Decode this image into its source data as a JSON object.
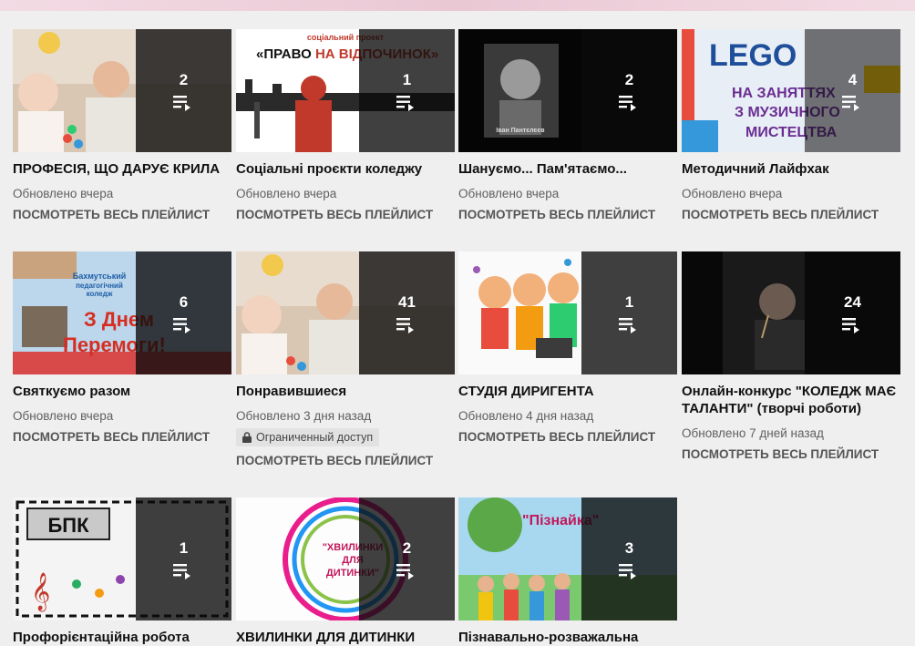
{
  "playlists": [
    {
      "title": "ПРОФЕСІЯ, ЩО ДАРУЄ КРИЛА",
      "count": "2",
      "updated": "Обновлено вчера",
      "link": "ПОСМОТРЕТЬ ВЕСЬ ПЛЕЙЛИСТ"
    },
    {
      "title": "Соціальні проєкти коледжу",
      "count": "1",
      "updated": "Обновлено вчера",
      "link": "ПОСМОТРЕТЬ ВЕСЬ ПЛЕЙЛИСТ",
      "art_small": "соціальний проект",
      "art_text1": "«ПРАВО ",
      "art_text2": "НА ВІДПОЧИНОК»"
    },
    {
      "title": "Шануємо... Пам'ятаємо...",
      "count": "2",
      "updated": "Обновлено вчера",
      "link": "ПОСМОТРЕТЬ ВЕСЬ ПЛЕЙЛИСТ",
      "art_caption": "Іван Пантєлєєв"
    },
    {
      "title": "Методичний Лайфхак",
      "count": "4",
      "updated": "Обновлено вчера",
      "link": "ПОСМОТРЕТЬ ВЕСЬ ПЛЕЙЛИСТ",
      "art_lego": "LEGO",
      "art_l1": "НА ЗАНЯТТЯХ",
      "art_l2": "З МУЗИЧНОГО",
      "art_l3": "МИСТЕЦТВА"
    },
    {
      "title": "Святкуємо разом",
      "count": "6",
      "updated": "Обновлено вчера",
      "link": "ПОСМОТРЕТЬ ВЕСЬ ПЛЕЙЛИСТ",
      "art_h1": "Бахмутський",
      "art_h2": "педагогічний",
      "art_h3": "коледж",
      "art_big1": "З Днем",
      "art_big2": "Перемоги!"
    },
    {
      "title": "Понравившиеся",
      "count": "41",
      "updated": "Обновлено 3 дня назад",
      "badge": "Ограниченный доступ",
      "link": "ПОСМОТРЕТЬ ВЕСЬ ПЛЕЙЛИСТ"
    },
    {
      "title": "СТУДІЯ ДИРИГЕНТА",
      "count": "1",
      "updated": "Обновлено 4 дня назад",
      "link": "ПОСМОТРЕТЬ ВЕСЬ ПЛЕЙЛИСТ"
    },
    {
      "title": "Онлайн-конкурс \"КОЛЕДЖ МАЄ ТАЛАНТИ\" (творчі роботи)",
      "count": "24",
      "updated": "Обновлено 7 дней назад",
      "link": "ПОСМОТРЕТЬ ВЕСЬ ПЛЕЙЛИСТ"
    },
    {
      "title": "Профорієнтаційна робота",
      "count": "1",
      "art_label": "БПК"
    },
    {
      "title": "ХВИЛИНКИ ДЛЯ ДИТИНКИ",
      "count": "2",
      "art_t1": "\"ХВИЛИНКИ",
      "art_t2": "ДЛЯ",
      "art_t3": "ДИТИНКИ\""
    },
    {
      "title": "Пізнавально-розважальна",
      "count": "3",
      "art_label": "\"Пізнайка\""
    }
  ],
  "colors": {
    "background": "#efefef",
    "overlay": "#0a0a0a",
    "title": "#111111",
    "meta": "#606060"
  },
  "icons": {
    "playlist": "playlist-play-icon",
    "lock": "lock-icon"
  }
}
